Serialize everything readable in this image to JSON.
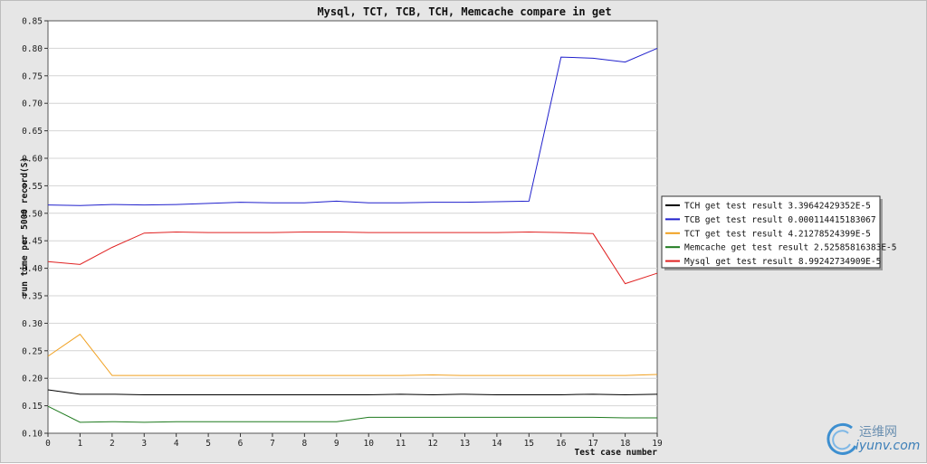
{
  "chart_data": {
    "type": "line",
    "title": "Mysql, TCT, TCB, TCH, Memcache compare in get",
    "xlabel": "Test case number",
    "ylabel": "run time per 5000 record(S)",
    "x": [
      0,
      1,
      2,
      3,
      4,
      5,
      6,
      7,
      8,
      9,
      10,
      11,
      12,
      13,
      14,
      15,
      16,
      17,
      18,
      19
    ],
    "xlim": [
      0,
      19
    ],
    "ylim": [
      0.1,
      0.85
    ],
    "yticks": [
      "0.10",
      "0.15",
      "0.20",
      "0.25",
      "0.30",
      "0.35",
      "0.40",
      "0.45",
      "0.50",
      "0.55",
      "0.60",
      "0.65",
      "0.70",
      "0.75",
      "0.80",
      "0.85"
    ],
    "grid": "horizontal",
    "legend_position": "right",
    "series": [
      {
        "name": "TCH get test result 3.39642429352E-5",
        "color": "#000000",
        "values": [
          0.179,
          0.171,
          0.171,
          0.17,
          0.17,
          0.17,
          0.17,
          0.17,
          0.17,
          0.17,
          0.17,
          0.171,
          0.17,
          0.171,
          0.17,
          0.17,
          0.17,
          0.171,
          0.17,
          0.171
        ]
      },
      {
        "name": "TCB get test result 0.000114415183067",
        "color": "#1f1fcc",
        "values": [
          0.515,
          0.514,
          0.516,
          0.515,
          0.516,
          0.518,
          0.52,
          0.519,
          0.519,
          0.522,
          0.519,
          0.519,
          0.52,
          0.52,
          0.521,
          0.522,
          0.784,
          0.782,
          0.775,
          0.8
        ]
      },
      {
        "name": "TCT get test result 4.21278524399E-5",
        "color": "#f0a020",
        "values": [
          0.24,
          0.28,
          0.205,
          0.205,
          0.205,
          0.205,
          0.205,
          0.205,
          0.205,
          0.205,
          0.205,
          0.205,
          0.206,
          0.205,
          0.205,
          0.205,
          0.205,
          0.205,
          0.205,
          0.207
        ]
      },
      {
        "name": "Memcache get test result 2.52585816383E-5",
        "color": "#1e7a1e",
        "values": [
          0.149,
          0.12,
          0.121,
          0.12,
          0.121,
          0.121,
          0.121,
          0.121,
          0.121,
          0.121,
          0.129,
          0.129,
          0.129,
          0.129,
          0.129,
          0.129,
          0.129,
          0.129,
          0.128,
          0.128
        ]
      },
      {
        "name": "Mysql get test result 8.99242734909E-5",
        "color": "#e02020",
        "values": [
          0.412,
          0.407,
          0.438,
          0.464,
          0.466,
          0.465,
          0.465,
          0.465,
          0.466,
          0.466,
          0.465,
          0.465,
          0.465,
          0.465,
          0.465,
          0.466,
          0.465,
          0.463,
          0.372,
          0.391
        ]
      }
    ]
  },
  "watermark": {
    "cn": "运维网",
    "en": "iyunv.com"
  }
}
